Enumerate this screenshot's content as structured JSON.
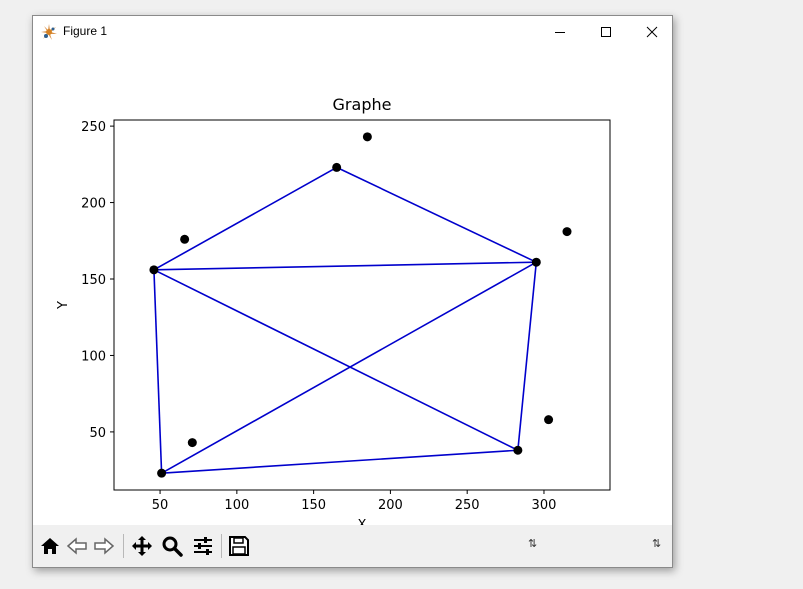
{
  "window": {
    "title": "Figure 1",
    "icon": "matplotlib-figure-icon",
    "controls": [
      "minimize-icon",
      "maximize-icon",
      "close-icon"
    ]
  },
  "toolbar": {
    "buttons": [
      "home-icon",
      "back-arrow-icon",
      "forward-arrow-icon",
      "pan-move-icon",
      "zoom-magnifier-icon",
      "configure-subplots-icon",
      "save-floppy-icon"
    ],
    "status_left": "⇅",
    "status_right": "⇅"
  },
  "chart_data": {
    "type": "scatter",
    "title": "Graphe",
    "xlabel": "X",
    "ylabel": "Y",
    "xlim": [
      20,
      343
    ],
    "ylim": [
      12,
      254
    ],
    "xticks": [
      50,
      100,
      150,
      200,
      250,
      300
    ],
    "yticks": [
      50,
      100,
      150,
      200,
      250
    ],
    "grid": false,
    "point_color": "#000000",
    "edge_color": "#0000cc",
    "points": [
      {
        "x": 46,
        "y": 156
      },
      {
        "x": 51,
        "y": 23
      },
      {
        "x": 165,
        "y": 223
      },
      {
        "x": 295,
        "y": 161
      },
      {
        "x": 283,
        "y": 38
      },
      {
        "x": 185,
        "y": 243
      },
      {
        "x": 66,
        "y": 176
      },
      {
        "x": 71,
        "y": 43
      },
      {
        "x": 315,
        "y": 181
      },
      {
        "x": 303,
        "y": 58
      }
    ],
    "edges": [
      [
        [
          46,
          156
        ],
        [
          165,
          223
        ]
      ],
      [
        [
          165,
          223
        ],
        [
          295,
          161
        ]
      ],
      [
        [
          46,
          156
        ],
        [
          295,
          161
        ]
      ],
      [
        [
          46,
          156
        ],
        [
          51,
          23
        ]
      ],
      [
        [
          46,
          156
        ],
        [
          283,
          38
        ]
      ],
      [
        [
          51,
          23
        ],
        [
          295,
          161
        ]
      ],
      [
        [
          51,
          23
        ],
        [
          283,
          38
        ]
      ],
      [
        [
          283,
          38
        ],
        [
          295,
          161
        ]
      ]
    ]
  }
}
